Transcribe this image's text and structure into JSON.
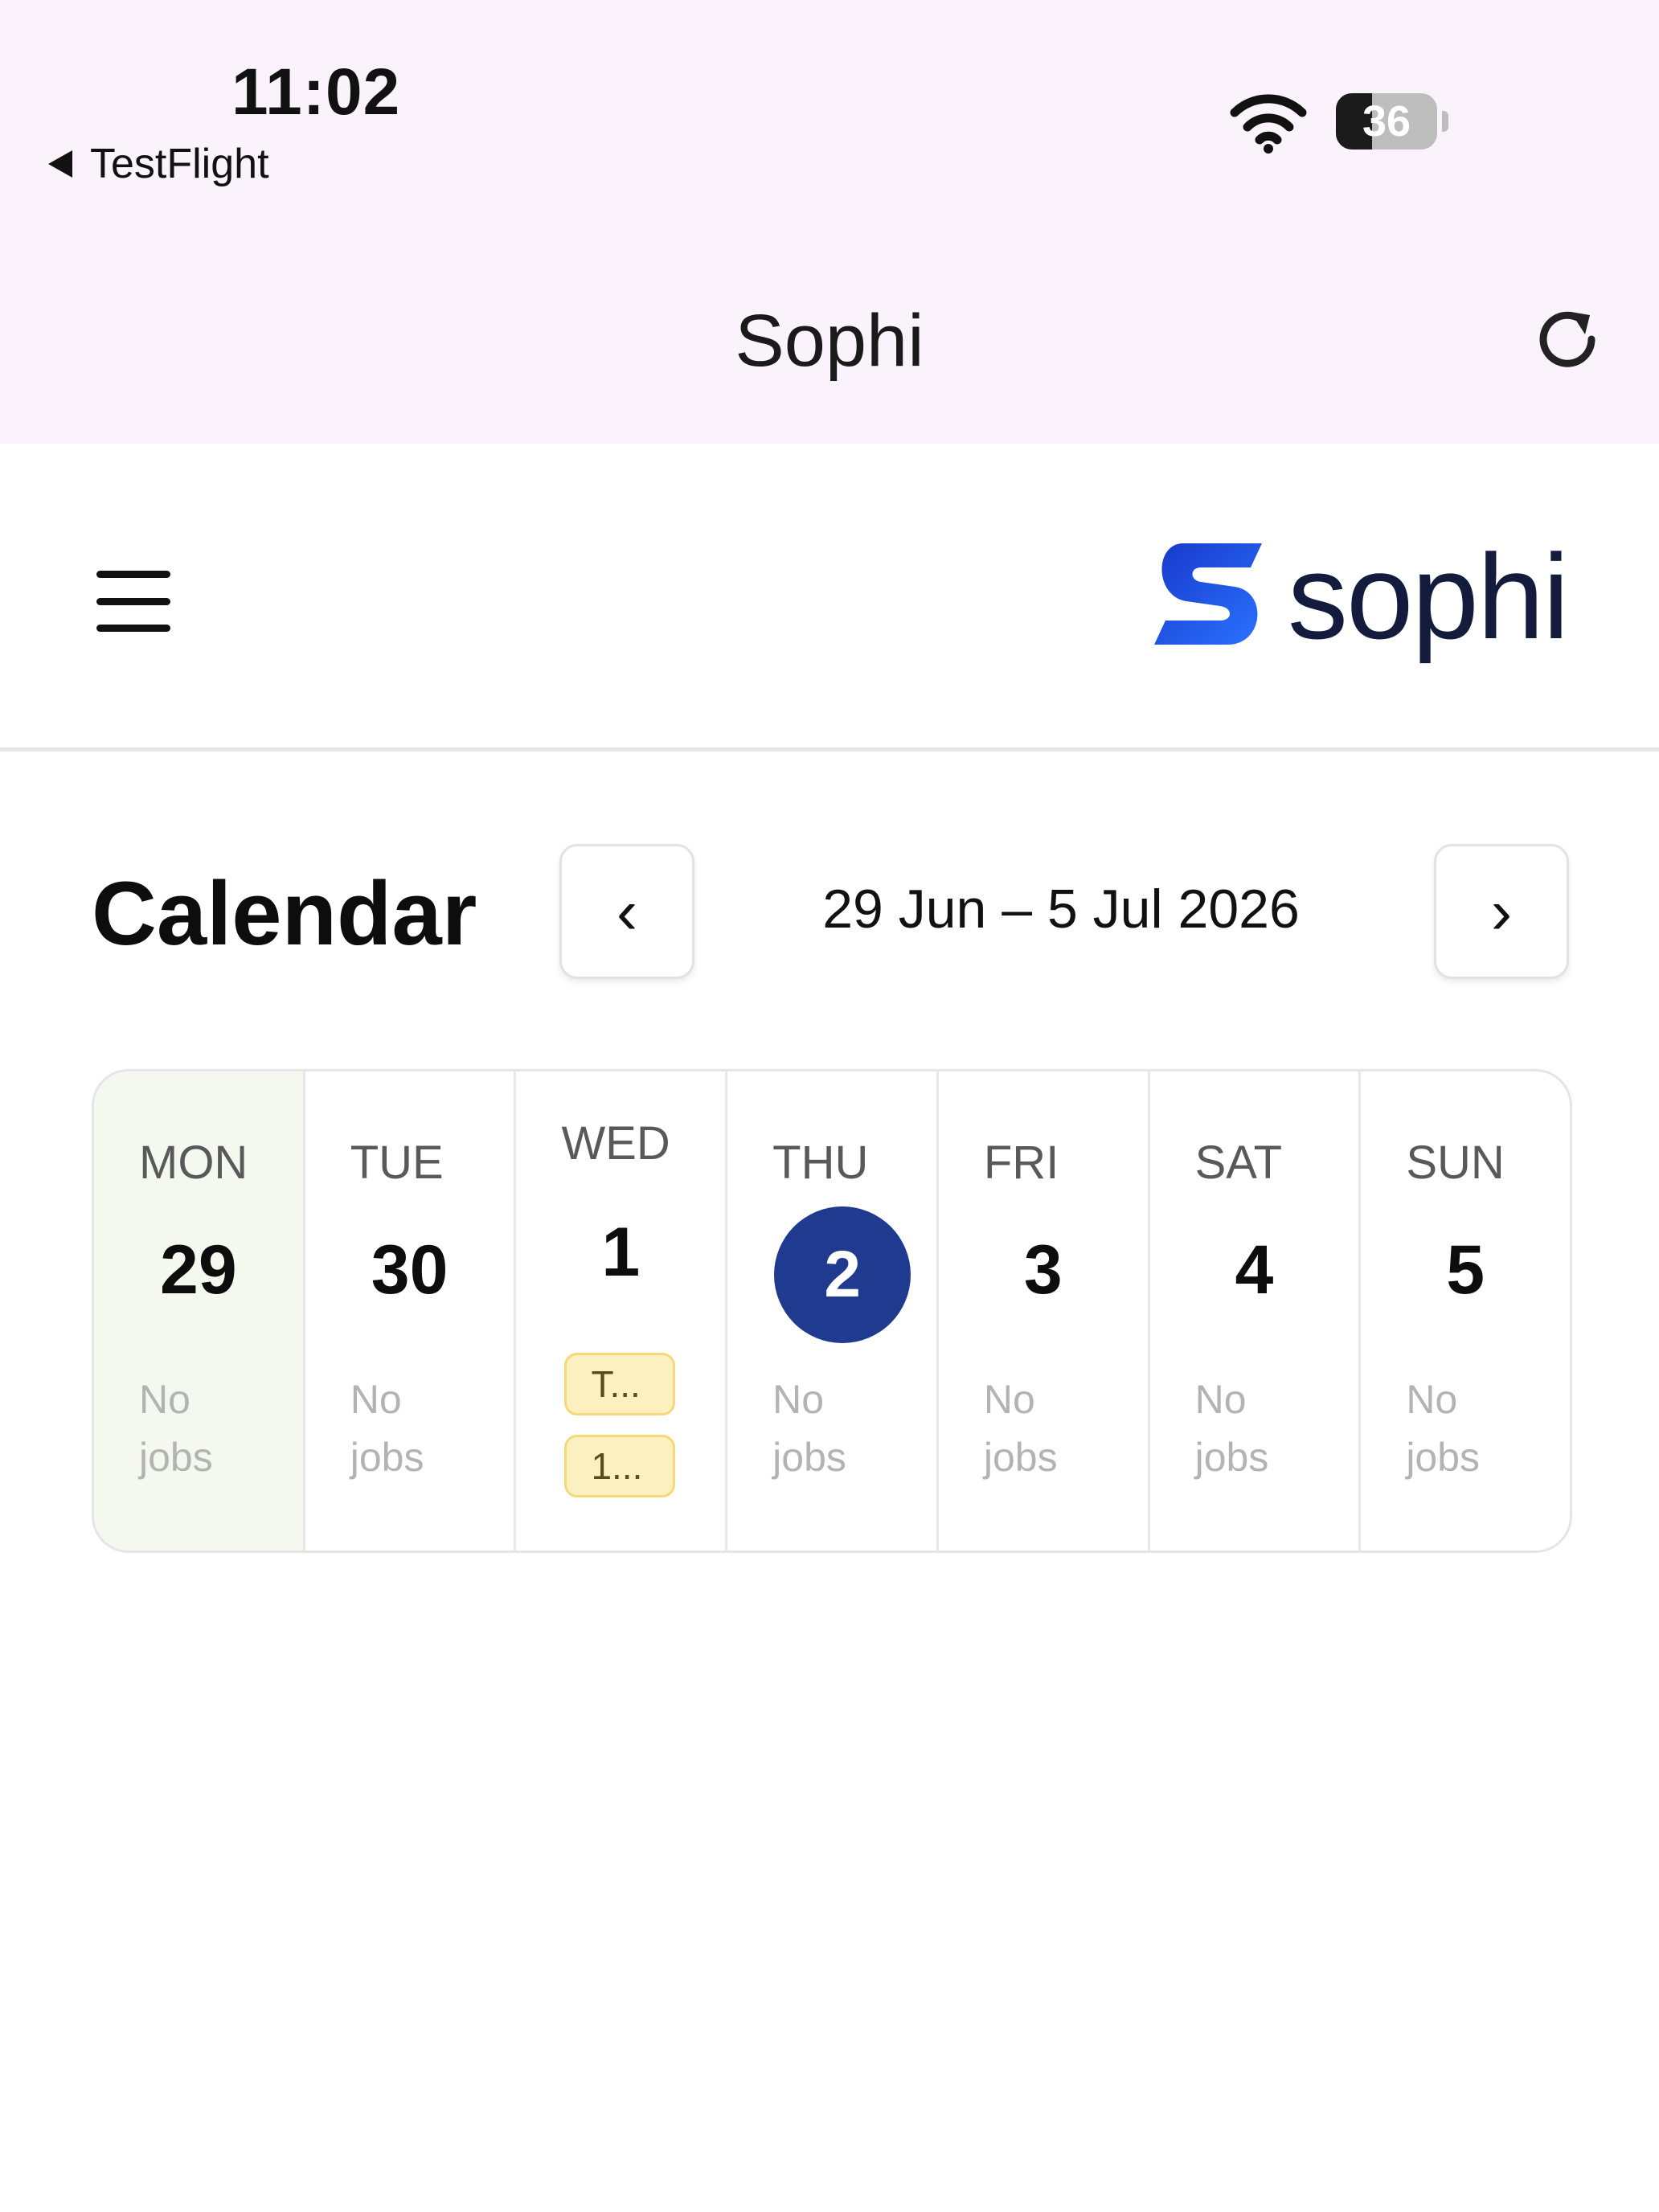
{
  "status_bar": {
    "time": "11:02",
    "back_app": "TestFlight",
    "battery_level": "36",
    "icons": [
      "wifi-icon",
      "battery-icon"
    ]
  },
  "nav_bar": {
    "title": "Sophi",
    "reload_icon": "reload-icon"
  },
  "app_header": {
    "menu_icon": "hamburger-menu-icon",
    "logo_text": "sophi",
    "brand_colors": {
      "logo_blue": "#1f4fe0",
      "logo_text": "#141c3e"
    }
  },
  "calendar": {
    "title": "Calendar",
    "prev_icon": "chevron-left-icon",
    "next_icon": "chevron-right-icon",
    "prev_symbol": "‹",
    "next_symbol": "›",
    "range": "29 Jun – 5 Jul 2026",
    "today_color": "#1f3a8f",
    "days": [
      {
        "name": "MON",
        "num": "29",
        "empty_line1": "No",
        "empty_line2": "jobs"
      },
      {
        "name": "TUE",
        "num": "30",
        "empty_line1": "No",
        "empty_line2": "jobs"
      },
      {
        "name": "WED",
        "num": "1",
        "jobs": [
          "T...",
          "1..."
        ]
      },
      {
        "name": "THU",
        "num": "2",
        "today": true,
        "empty_line1": "No",
        "empty_line2": "jobs"
      },
      {
        "name": "FRI",
        "num": "3",
        "empty_line1": "No",
        "empty_line2": "jobs"
      },
      {
        "name": "SAT",
        "num": "4",
        "empty_line1": "No",
        "empty_line2": "jobs"
      },
      {
        "name": "SUN",
        "num": "5",
        "empty_line1": "No",
        "empty_line2": "jobs"
      }
    ]
  }
}
